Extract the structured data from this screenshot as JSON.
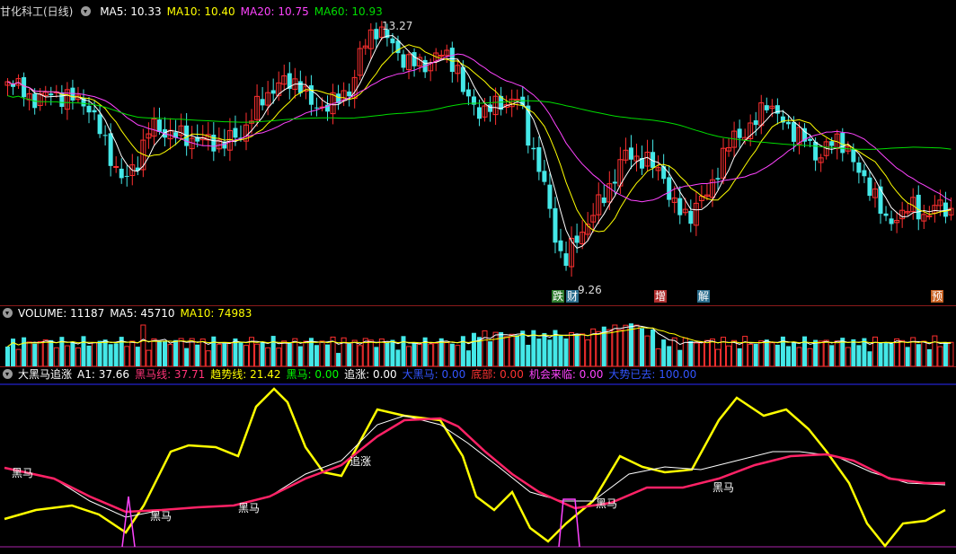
{
  "price_panel": {
    "title": "甘化科工(日线)",
    "ma_labels": [
      {
        "text": "MA5: 10.33",
        "color": "#ffffff"
      },
      {
        "text": "MA10: 10.40",
        "color": "#ffff00"
      },
      {
        "text": "MA20: 10.75",
        "color": "#ff44ff"
      },
      {
        "text": "MA60: 10.93",
        "color": "#00dd00"
      }
    ],
    "high_label": "13.27",
    "low_label": "9.26",
    "event_tags": [
      {
        "text": "跌",
        "color": "#ffffff",
        "bg": "#2f7d2f"
      },
      {
        "text": "财",
        "color": "#ffffff",
        "bg": "#2b6e8e"
      },
      {
        "text": "增",
        "color": "#ffffff",
        "bg": "#b03030"
      },
      {
        "text": "解",
        "color": "#ffffff",
        "bg": "#2b6e8e"
      },
      {
        "text": "预",
        "color": "#ffffff",
        "bg": "#c86020"
      }
    ]
  },
  "volume_panel": {
    "labels": [
      {
        "text": "VOLUME: 11187",
        "color": "#ffffff"
      },
      {
        "text": "MA5: 45710",
        "color": "#ffffff"
      },
      {
        "text": "MA10: 74983",
        "color": "#ffff00"
      }
    ]
  },
  "indicator_panel": {
    "labels": [
      {
        "text": "大黑马追涨",
        "color": "#ffffff"
      },
      {
        "text": "A1: 37.66",
        "color": "#ffffff"
      },
      {
        "text": "黑马线: 37.71",
        "color": "#ff3377"
      },
      {
        "text": "趋势线: 21.42",
        "color": "#ffff00"
      },
      {
        "text": "黑马: 0.00",
        "color": "#00ff00"
      },
      {
        "text": "追涨: 0.00",
        "color": "#ffffff"
      },
      {
        "text": "大黑马: 0.00",
        "color": "#3355ff"
      },
      {
        "text": "底部: 0.00",
        "color": "#ff3333"
      },
      {
        "text": "机会来临: 0.00",
        "color": "#ff44ff"
      },
      {
        "text": "大势已去: 100.00",
        "color": "#3355ff"
      }
    ],
    "signal_labels": [
      "黑马",
      "黑马",
      "黑马",
      "追涨",
      "黑马",
      "黑马"
    ]
  },
  "colors": {
    "up": "#ff3030",
    "down": "#44e8e8",
    "grid": "#8b1a1a"
  }
}
